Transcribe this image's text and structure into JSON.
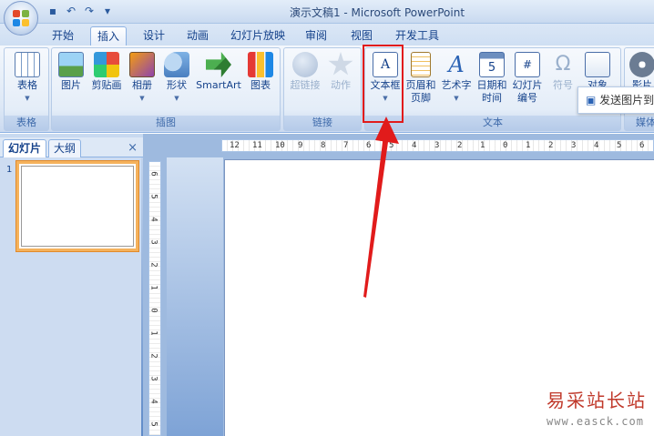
{
  "window": {
    "title": "演示文稿1 - Microsoft PowerPoint",
    "quick_access": [
      "save-icon",
      "undo-icon",
      "redo-icon"
    ]
  },
  "tabs": [
    {
      "label": "开始"
    },
    {
      "label": "插入",
      "active": true
    },
    {
      "label": "设计"
    },
    {
      "label": "动画"
    },
    {
      "label": "幻灯片放映"
    },
    {
      "label": "审阅"
    },
    {
      "label": "视图"
    },
    {
      "label": "开发工具"
    }
  ],
  "ribbon": {
    "groups": {
      "table": "表格",
      "illustrations": "插图",
      "links": "链接",
      "text": "文本",
      "media": "媒体"
    },
    "buttons": {
      "table": "表格",
      "picture": "图片",
      "clipart": "剪贴画",
      "album": "相册",
      "shapes": "形状",
      "smartart": "SmartArt",
      "chart": "图表",
      "hyperlink": "超链接",
      "action": "动作",
      "textbox": "文本框",
      "header_line1": "页眉和",
      "header_line2": "页脚",
      "wordart": "艺术字",
      "datetime_line1": "日期和",
      "datetime_line2": "时间",
      "slidenum_line1": "幻灯片",
      "slidenum_line2": "编号",
      "symbol": "符号",
      "object": "对象",
      "media_partial": "影片"
    },
    "tooltip": "发送图片到"
  },
  "left_pane": {
    "tab_slides": "幻灯片",
    "tab_outline": "大纲",
    "close": "×",
    "slide_number": "1"
  },
  "ruler": {
    "h_labels": [
      "12",
      "11",
      "10",
      "9",
      "8",
      "7",
      "6",
      "5",
      "4",
      "3",
      "2",
      "1",
      "0",
      "1",
      "2",
      "3",
      "4",
      "5",
      "6"
    ],
    "v_labels": [
      "6",
      "5",
      "4",
      "3",
      "2",
      "1",
      "0",
      "1",
      "2",
      "3",
      "4",
      "5"
    ]
  },
  "watermark": {
    "line1": "易采站长站",
    "line2": "www.easck.com"
  },
  "colors": {
    "highlight": "#e11b1b",
    "ribbon_text": "#15428b",
    "slide_selected": "#f5b25c"
  }
}
